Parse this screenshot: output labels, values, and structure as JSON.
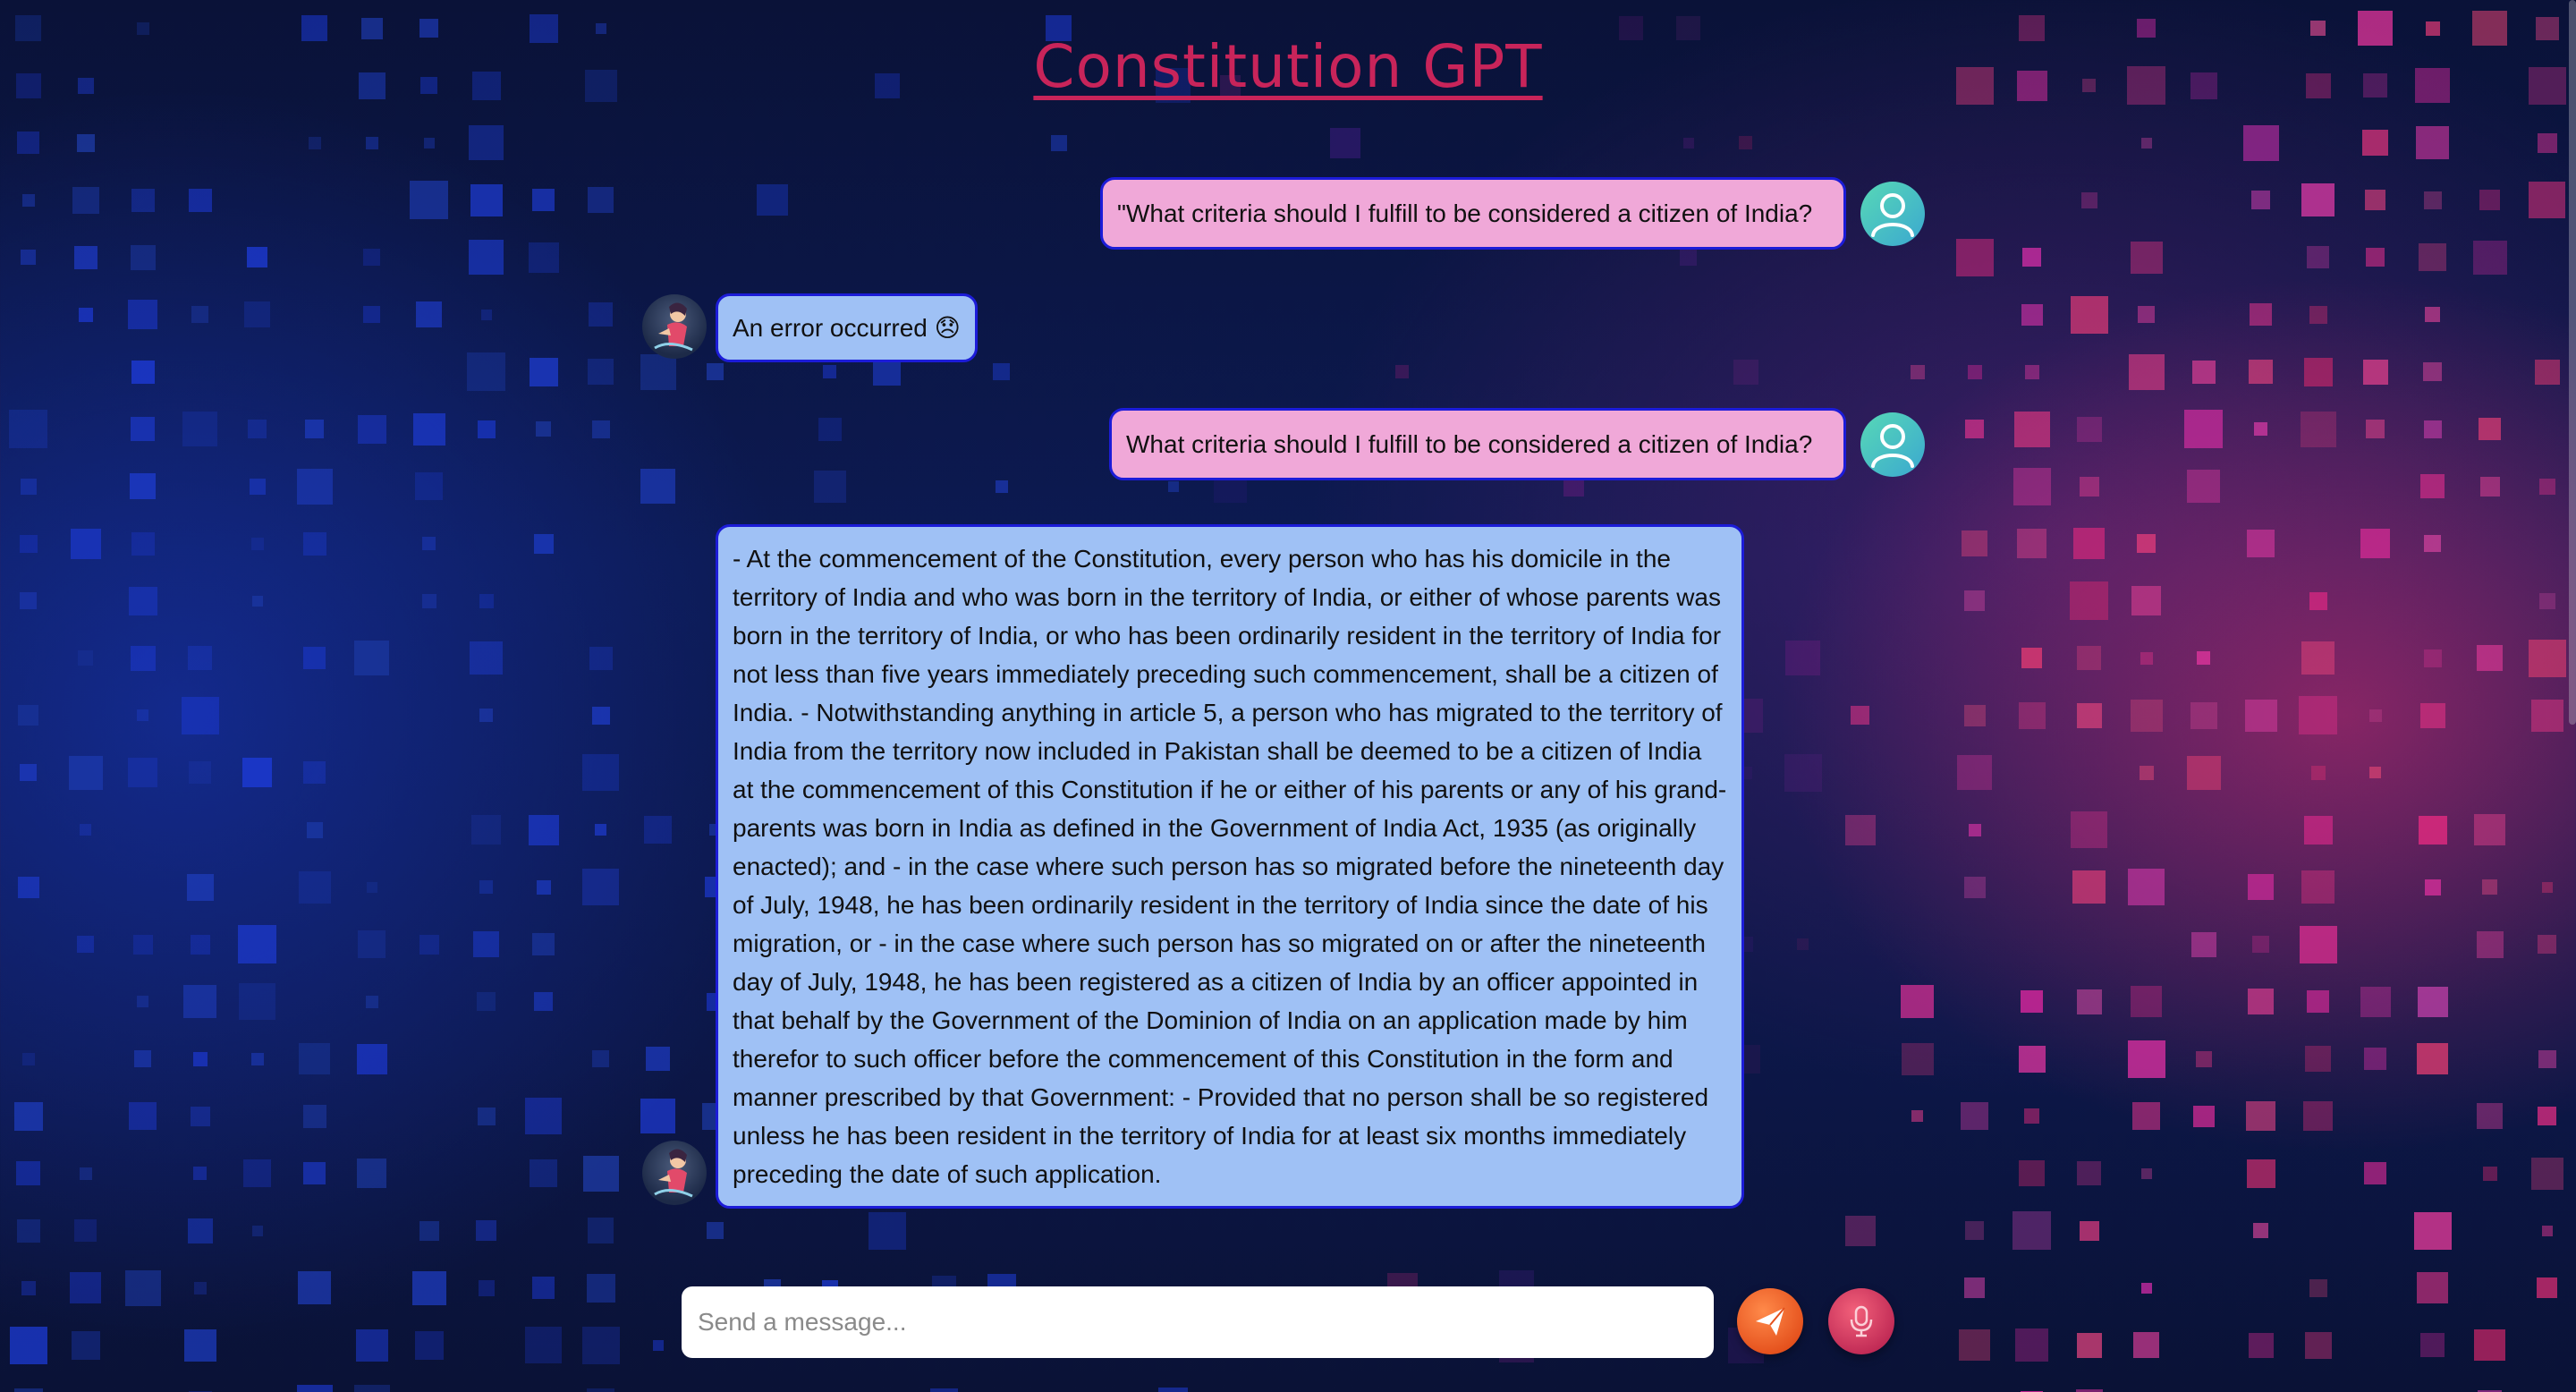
{
  "app": {
    "title": "Constitution GPT"
  },
  "messages": [
    {
      "role": "user",
      "text": "\"What criteria should I fulfill to be considered a citizen of India?"
    },
    {
      "role": "bot",
      "text": "An error occurred 😞"
    },
    {
      "role": "user",
      "text": "What criteria should I fulfill to be considered a citizen of India?"
    },
    {
      "role": "bot",
      "text": "- At the commencement of the Constitution, every person who has his domicile in the territory of India and who was born in the territory of India, or either of whose parents was born in the territory of India, or who has been ordinarily resident in the territory of India for not less than five years immediately preceding such commencement, shall be a citizen of India. - Notwithstanding anything in article 5, a person who has migrated to the territory of India from the territory now included in Pakistan shall be deemed to be a citizen of India at the commencement of this Constitution if he or either of his parents or any of his grand-parents was born in India as defined in the Government of India Act, 1935 (as originally enacted); and - in the case where such person has so migrated before the nineteenth day of July, 1948, he has been ordinarily resident in the territory of India since the date of his migration, or - in the case where such person has so migrated on or after the nineteenth day of July, 1948, he has been registered as a citizen of India by an officer appointed in that behalf by the Government of the Dominion of India on an application made by him therefor to such officer before the commencement of this Constitution in the form and manner prescribed by that Government: - Provided that no person shall be so registered unless he has been resident in the territory of India for at least six months immediately preceding the date of such application."
    }
  ],
  "composer": {
    "placeholder": "Send a message...",
    "value": ""
  },
  "icons": {
    "user_avatar": "user-icon",
    "bot_avatar": "bot-avatar",
    "send": "paper-plane-icon",
    "mic": "microphone-icon"
  },
  "colors": {
    "title": "#c8245a",
    "user_bubble": "#f0a8d8",
    "bot_bubble": "#9fc1f5",
    "bubble_border": "#1c1cd8",
    "send_button": "#e4501c",
    "mic_button": "#c02a55"
  }
}
